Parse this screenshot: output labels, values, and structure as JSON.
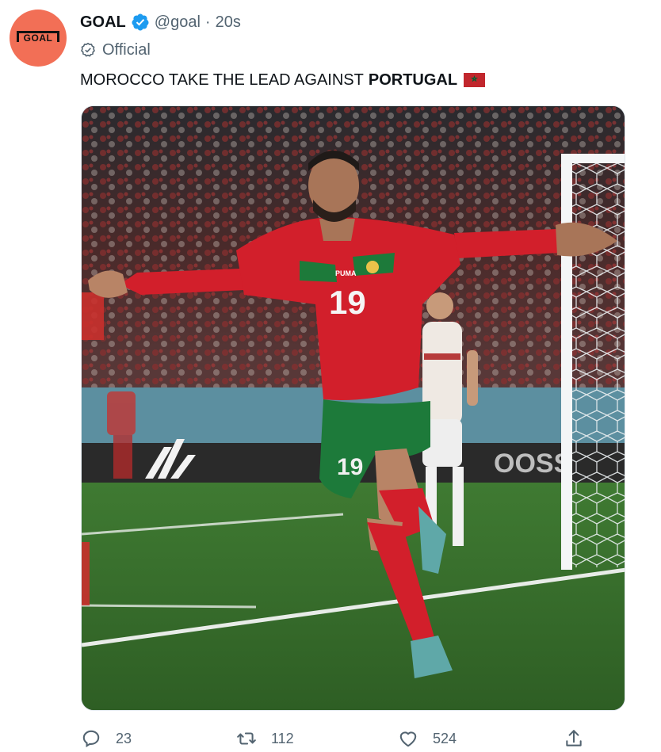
{
  "author": {
    "avatar_text": "GOAL",
    "name": "GOAL",
    "handle": "@goal",
    "separator": "·",
    "time": "20s",
    "label": "Official"
  },
  "tweet": {
    "text": "MOROCCO TAKE THE LEAD AGAINST",
    "text_bold": "PORTUGAL",
    "flag_emoji": "morocco-flag"
  },
  "media": {
    "shirt_number": "19",
    "shirt_brand": "PUMA"
  },
  "actions": {
    "replies": "23",
    "retweets": "112",
    "likes": "524"
  },
  "colors": {
    "avatar_bg": "#f26f56",
    "verified_blue": "#1d9bf0",
    "secondary_text": "#536471",
    "morocco_red": "#c1272d",
    "morocco_green": "#006233"
  },
  "icons": {
    "verified": "verified-badge-icon",
    "official": "official-check-icon",
    "reply": "reply-icon",
    "retweet": "retweet-icon",
    "like": "heart-icon",
    "share": "share-icon"
  }
}
